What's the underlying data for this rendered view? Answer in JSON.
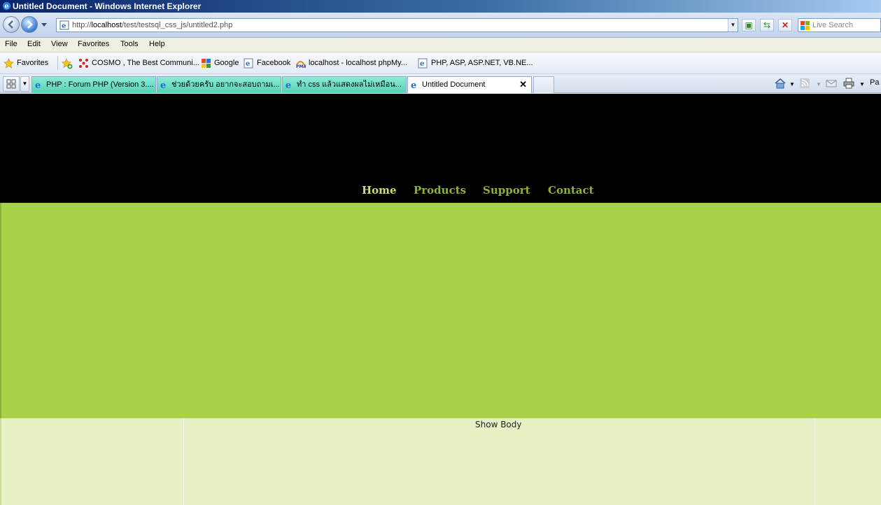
{
  "window": {
    "title": "Untitled Document - Windows Internet Explorer"
  },
  "address_bar": {
    "url_prefix": "http://",
    "url_host": "localhost",
    "url_path": "/test/testsql_css_js/untitled2.php",
    "search_placeholder": "Live Search"
  },
  "menu": {
    "items": [
      "File",
      "Edit",
      "View",
      "Favorites",
      "Tools",
      "Help"
    ]
  },
  "favorites_bar": {
    "label": "Favorites",
    "items": [
      "COSMO , The Best Communi...",
      "Google",
      "Facebook",
      "localhost - localhost  phpMy...",
      "PHP, ASP, ASP.NET, VB.NE..."
    ]
  },
  "tabs": [
    {
      "label": "PHP : Forum PHP (Version 3....",
      "active": false
    },
    {
      "label": "ช่วยด้วยครับ อยากจะสอบถามเ...",
      "active": false
    },
    {
      "label": "ทำ css แล้วแสดงผลไม่เหมือน...",
      "active": false
    },
    {
      "label": "Untitled Document",
      "active": true
    }
  ],
  "command_bar": {
    "page_label": "Pa"
  },
  "site": {
    "nav": [
      "Home",
      "Products",
      "Support",
      "Contact"
    ],
    "body_text": "Show Body",
    "colors": {
      "header": "#000000",
      "banner": "#a9d149",
      "body": "#e6f1c6",
      "nav_active": "#c7df7a",
      "nav_inactive": "#8fb03a"
    }
  }
}
